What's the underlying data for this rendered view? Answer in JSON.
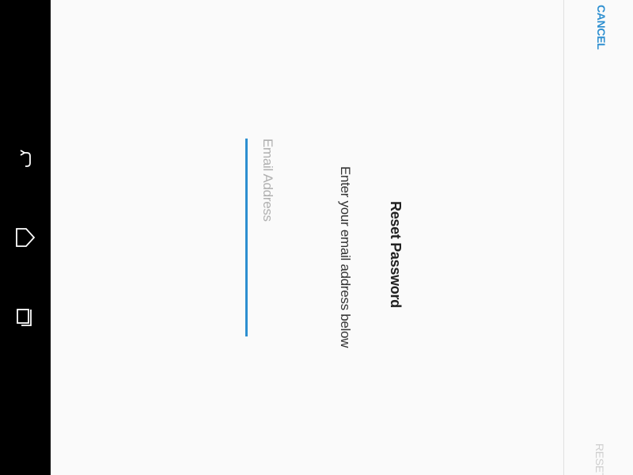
{
  "navigation_bar": {
    "buttons": [
      {
        "name": "back",
        "icon": "back-icon"
      },
      {
        "name": "home",
        "icon": "home-icon"
      },
      {
        "name": "recent_apps",
        "icon": "recent-apps-icon"
      }
    ]
  },
  "dialog": {
    "title": "Reset Password",
    "subtitle": "Enter your email address below",
    "email_field": {
      "value": "",
      "placeholder": "Email Address"
    }
  },
  "actions": {
    "cancel_label": "CANCEL",
    "reset_label": "RESET"
  },
  "colors": {
    "accent": "#2d8fd0",
    "background": "#fafafa",
    "nav_bar": "#000000",
    "disabled_text": "#cfcfcf",
    "placeholder_text": "#b0b0b0"
  }
}
